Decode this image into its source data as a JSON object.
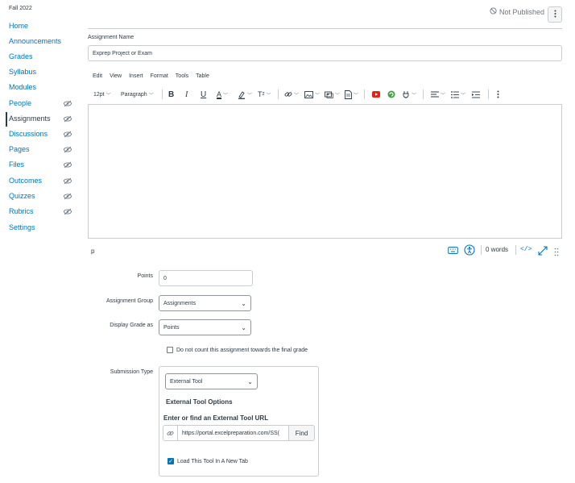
{
  "sidebar": {
    "term": "Fall 2022",
    "items": [
      {
        "label": "Home"
      },
      {
        "label": "Announcements"
      },
      {
        "label": "Grades"
      },
      {
        "label": "Syllabus"
      },
      {
        "label": "Modules"
      },
      {
        "label": "People",
        "hidden_icon": "eye-slash-icon"
      },
      {
        "label": "Assignments",
        "active": true,
        "hidden_icon": "eye-slash-icon"
      },
      {
        "label": "Discussions",
        "hidden_icon": "eye-slash-icon"
      },
      {
        "label": "Pages",
        "hidden_icon": "eye-slash-icon"
      },
      {
        "label": "Files",
        "hidden_icon": "eye-slash-icon"
      },
      {
        "label": "Outcomes",
        "hidden_icon": "eye-slash-icon"
      },
      {
        "label": "Quizzes",
        "hidden_icon": "eye-slash-icon"
      },
      {
        "label": "Rubrics",
        "hidden_icon": "eye-slash-icon"
      },
      {
        "label": "Settings"
      }
    ]
  },
  "header": {
    "publish_status": "Not Published"
  },
  "assignment": {
    "name_label": "Assignment Name",
    "name_value": "Exprep Project or Exam"
  },
  "editor": {
    "menu": [
      "Edit",
      "View",
      "Insert",
      "Format",
      "Tools",
      "Table"
    ],
    "font_size": "12pt",
    "block_format": "Paragraph",
    "path": "p",
    "word_count": "0 words",
    "html_toggle": "</>"
  },
  "form": {
    "points_label": "Points",
    "points_value": "0",
    "group_label": "Assignment Group",
    "group_value": "Assignments",
    "display_label": "Display Grade as",
    "display_value": "Points",
    "final_grade_checkbox": "Do not count this assignment towards the final grade",
    "submission_label": "Submission Type",
    "submission_value": "External Tool",
    "ext_options_title": "External Tool Options",
    "ext_url_label": "Enter or find an External Tool URL",
    "ext_url_value": "https://portal.excelpreparation.com/SS(",
    "find_label": "Find",
    "new_tab_label": "Load This Tool In A New Tab"
  },
  "colors": {
    "link": "#0374b5",
    "text": "#2d3b45",
    "border": "#c7cdd1",
    "youtube": "#e62117",
    "office": "#43a047"
  }
}
